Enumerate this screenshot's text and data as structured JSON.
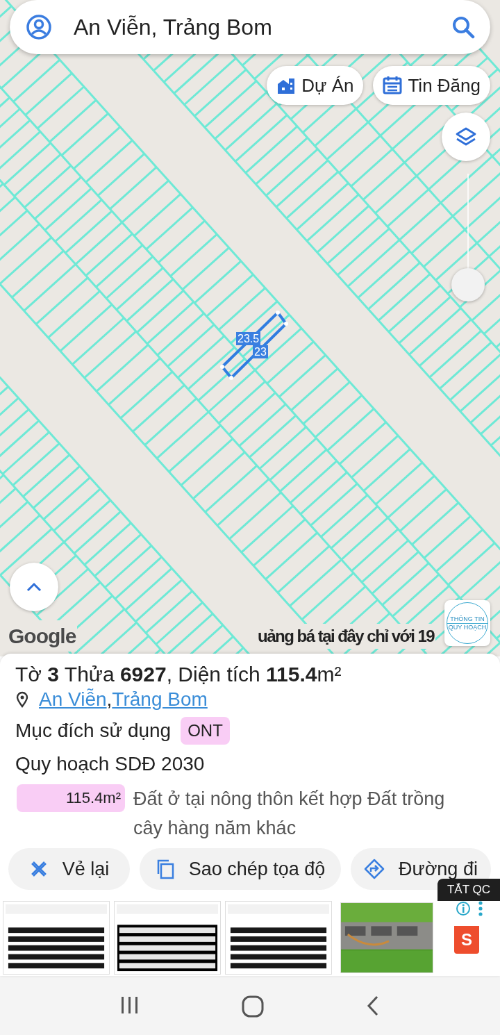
{
  "search": {
    "value": "An Viễn, Trảng Bom"
  },
  "map_buttons": [
    {
      "label": "Dự Án",
      "kind": "project"
    },
    {
      "label": "Tin Đăng",
      "kind": "listing"
    }
  ],
  "zoom": {
    "level": 0
  },
  "parcel_labels": [
    "23.5",
    "23"
  ],
  "map_logo": "Google",
  "ticker": "uảng bá tại đây chỉ với 19",
  "badge": {
    "line_1": "THÔNG TIN",
    "line_2": "QUY HOẠCH"
  },
  "parcel": {
    "title": "Tờ **3** Thửa **6927**, Diện tích **115.4**m²",
    "locations": [
      "An Viễn",
      "Trảng Bom"
    ],
    "separator": ",",
    "purpose_label": "Mục đích sử dụng",
    "purpose_code": "ONT",
    "plan_title": "Quy hoạch SDĐ 2030",
    "plan_rows": [
      {
        "area": "115.4m²",
        "description": "Đất ở tại nông thôn kết hợp Đất trồng cây hàng năm khác",
        "color": "#f9cdf5"
      }
    ]
  },
  "actions": [
    {
      "label": "Vẻ lại",
      "kind": "redraw"
    },
    {
      "label": "Sao chép tọa độ",
      "kind": "copy"
    },
    {
      "label": "Đường đi",
      "kind": "directions"
    }
  ],
  "ad": {
    "close_label": "TẮT QC",
    "brand_mark": "S"
  }
}
